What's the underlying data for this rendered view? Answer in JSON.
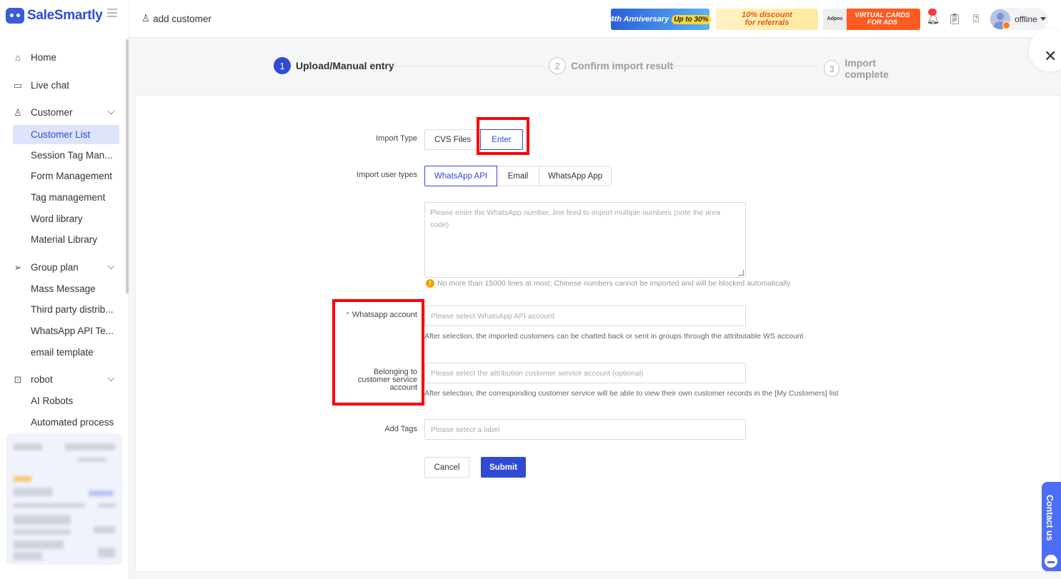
{
  "brand": {
    "name": "SaleSmartly"
  },
  "header": {
    "page_title": "add customer",
    "banners": {
      "anniversary": "4th Anniversary",
      "anniversary_pill": "Up to 30%",
      "discount_line1": "10% discount",
      "discount_line2": "for referrals",
      "adpos": "Adpos",
      "virtual_line1": "VIRTUAL CARDS",
      "virtual_line2": "FOR ADS"
    },
    "user_status": "offline"
  },
  "sidebar": {
    "items": [
      {
        "label": "Home",
        "icon": "home-icon"
      },
      {
        "label": "Live chat",
        "icon": "chat-icon"
      },
      {
        "label": "Customer",
        "icon": "users-icon"
      },
      {
        "label": "Group plan",
        "icon": "send-icon"
      },
      {
        "label": "robot",
        "icon": "robot-icon"
      }
    ],
    "customer_sub": [
      "Customer List",
      "Session Tag Man...",
      "Form Management",
      "Tag management",
      "Word library",
      "Material Library"
    ],
    "group_sub": [
      "Mass Message",
      "Third party distrib...",
      "WhatsApp API Te...",
      "email template"
    ],
    "robot_sub": [
      "AI Robots",
      "Automated process"
    ]
  },
  "steps": [
    {
      "num": "1",
      "label": "Upload/Manual entry"
    },
    {
      "num": "2",
      "label": "Confirm import result"
    },
    {
      "num": "3",
      "label": "Import complete"
    }
  ],
  "form": {
    "import_type_label": "Import Type",
    "import_type_options": [
      "CVS Files",
      "Enter"
    ],
    "user_types_label": "Import user types",
    "user_types_options": [
      "WhatsApp API",
      "Email",
      "WhatsApp App"
    ],
    "numbers_placeholder": "Please enter the WhatsApp number, line feed to import multiple numbers (note the area code)",
    "numbers_tip": "No more than 15000 lines at most; Chinese numbers cannot be imported and will be blocked automatically",
    "whatsapp_account_label": "Whatsapp account",
    "whatsapp_account_placeholder": "Please select WhatsApp API account",
    "whatsapp_account_help": "After selection, the imported customers can be chatted back or sent in groups through the attributable WS account",
    "service_account_label_l1": "Belonging to",
    "service_account_label_l2": "customer service",
    "service_account_label_l3": "account",
    "service_account_placeholder": "Please select the attribution customer service account (optional)",
    "service_account_help": "After selection, the corresponding customer service will be able to view their own customer records in the [My Customers] list",
    "tags_label": "Add Tags",
    "tags_placeholder": "Please select a label",
    "cancel": "Cancel",
    "submit": "Submit"
  },
  "contact": {
    "label": "Contact us"
  },
  "colors": {
    "primary": "#2f4bd4",
    "highlight": "#ff0000",
    "active_bg": "#dde4fb"
  }
}
